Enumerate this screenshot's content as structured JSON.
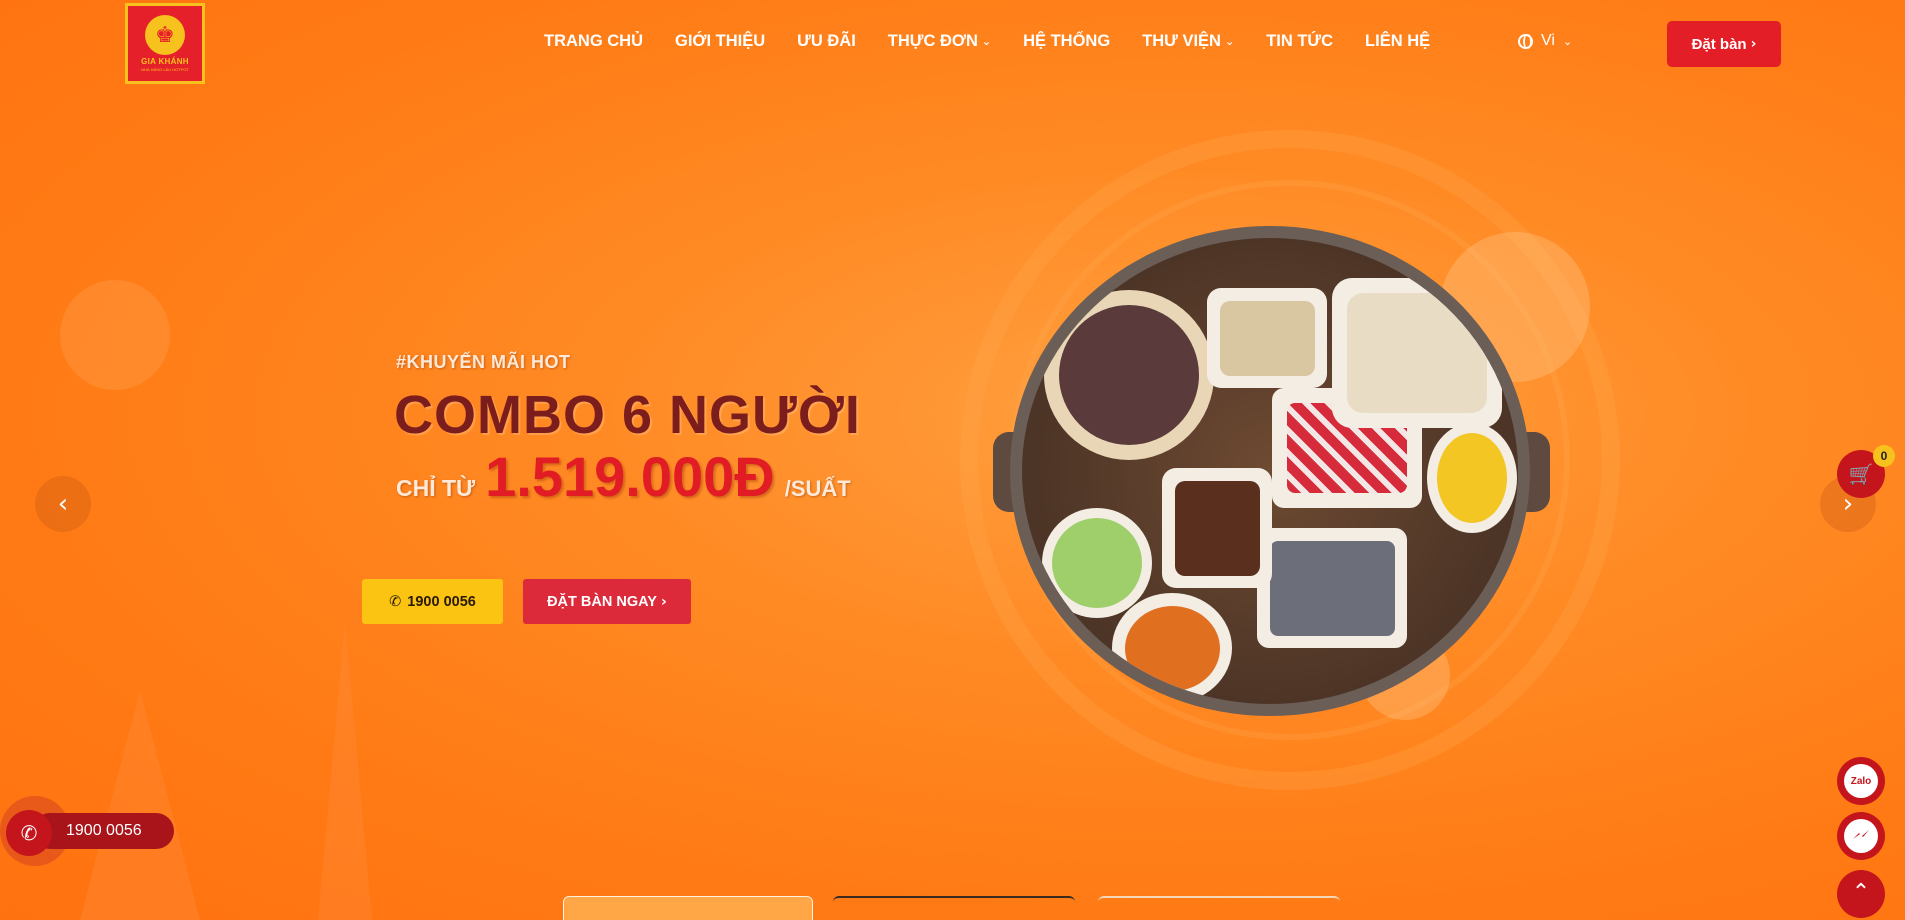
{
  "brand": {
    "logo_text": "GIA KHÁNH",
    "logo_subtext": "NHÀ HÀNG LẨU HOTPOT"
  },
  "nav": {
    "items": [
      {
        "label": "TRANG CHỦ",
        "has_dropdown": false
      },
      {
        "label": "GIỚI THIỆU",
        "has_dropdown": false
      },
      {
        "label": "ƯU ĐÃI",
        "has_dropdown": false
      },
      {
        "label": "THỰC ĐƠN",
        "has_dropdown": true
      },
      {
        "label": "HỆ THỐNG",
        "has_dropdown": false
      },
      {
        "label": "THƯ VIỆN",
        "has_dropdown": true
      },
      {
        "label": "TIN TỨC",
        "has_dropdown": false
      },
      {
        "label": "LIÊN HỆ",
        "has_dropdown": false
      }
    ],
    "language": "Vi",
    "book_button": "Đặt bàn"
  },
  "hero": {
    "tag": "#KHUYẾN MÃI HOT",
    "title": "COMBO 6 NGƯỜI",
    "price_prefix": "CHỈ TỪ",
    "price": "1.519.000Đ",
    "price_suffix": "/SUẤT",
    "phone_button": "1900 0056",
    "book_button": "ĐẶT BÀN NGAY"
  },
  "widgets": {
    "cart_count": "0",
    "zalo_label": "Zalo",
    "hotline": "1900 0056"
  },
  "colors": {
    "background": "#ff8a24",
    "brand_red": "#e41e26",
    "accent_yellow": "#fbc312",
    "title_maroon": "#7c1d1d"
  }
}
